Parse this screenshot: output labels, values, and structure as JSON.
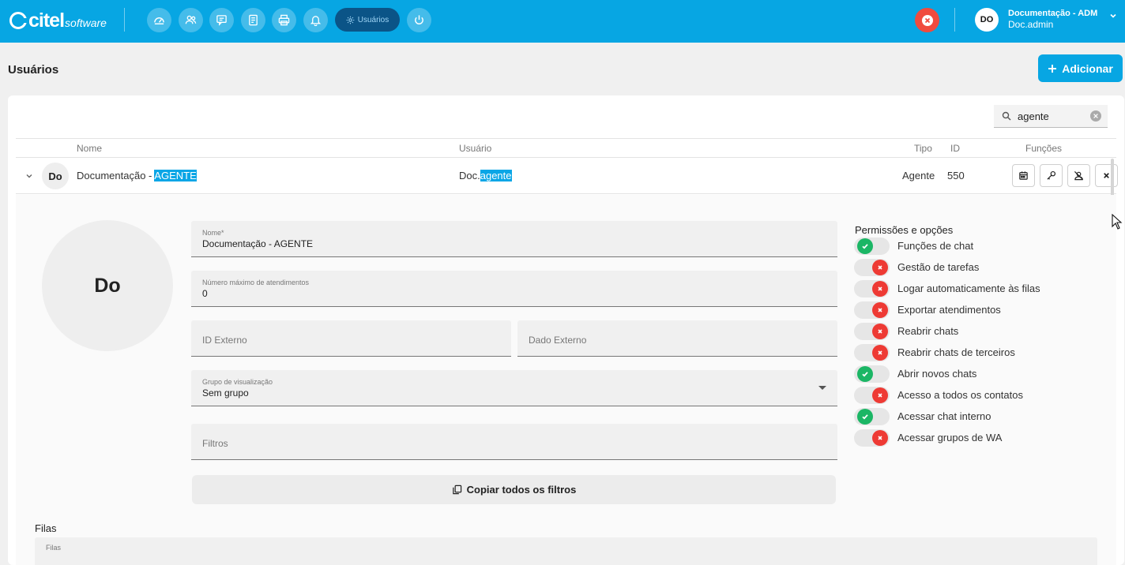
{
  "app": {
    "logo_word": "citel",
    "logo_sub": "software",
    "active_nav_label": "Usuários",
    "nav_icons": [
      "dashboard-icon",
      "contacts-icon",
      "chat-icon",
      "report-icon",
      "print-icon",
      "bell-icon",
      "settings-icon",
      "power-icon"
    ],
    "brand_color": "#07a6e3"
  },
  "user": {
    "initials": "DO",
    "name": "Documentação - ADM",
    "login": "Doc.admin"
  },
  "page": {
    "title": "Usuários",
    "add_label": "Adicionar"
  },
  "search": {
    "value": "agente"
  },
  "table": {
    "headers": {
      "nome": "Nome",
      "usuario": "Usuário",
      "tipo": "Tipo",
      "id": "ID",
      "funcoes": "Funções"
    },
    "row": {
      "initials": "Do",
      "name_prefix": "Documentação - ",
      "name_match": "AGENTE",
      "user_prefix": "Doc.",
      "user_match": "agente",
      "tipo": "Agente",
      "id": "550"
    }
  },
  "detail": {
    "avatar_initials": "Do",
    "nome_label": "Nome*",
    "nome_value": "Documentação - AGENTE",
    "max_label": "Número máximo de atendimentos",
    "max_value": "0",
    "id_externo_placeholder": "ID Externo",
    "dado_externo_placeholder": "Dado Externo",
    "grupo_label": "Grupo de visualização",
    "grupo_value": "Sem grupo",
    "filtros_placeholder": "Filtros",
    "copy_label": "Copiar todos os filtros",
    "filas_title": "Filas",
    "filas_label": "Filas"
  },
  "permissions": {
    "title": "Permissões e opções",
    "items": [
      {
        "label": "Funções de chat",
        "enabled": true
      },
      {
        "label": "Gestão de tarefas",
        "enabled": false
      },
      {
        "label": "Logar automaticamente às filas",
        "enabled": false
      },
      {
        "label": "Exportar atendimentos",
        "enabled": false
      },
      {
        "label": "Reabrir chats",
        "enabled": false
      },
      {
        "label": "Reabrir chats de terceiros",
        "enabled": false
      },
      {
        "label": "Abrir novos chats",
        "enabled": true
      },
      {
        "label": "Acesso a todos os contatos",
        "enabled": false
      },
      {
        "label": "Acessar chat interno",
        "enabled": true
      },
      {
        "label": "Acessar grupos de WA",
        "enabled": false
      }
    ]
  }
}
